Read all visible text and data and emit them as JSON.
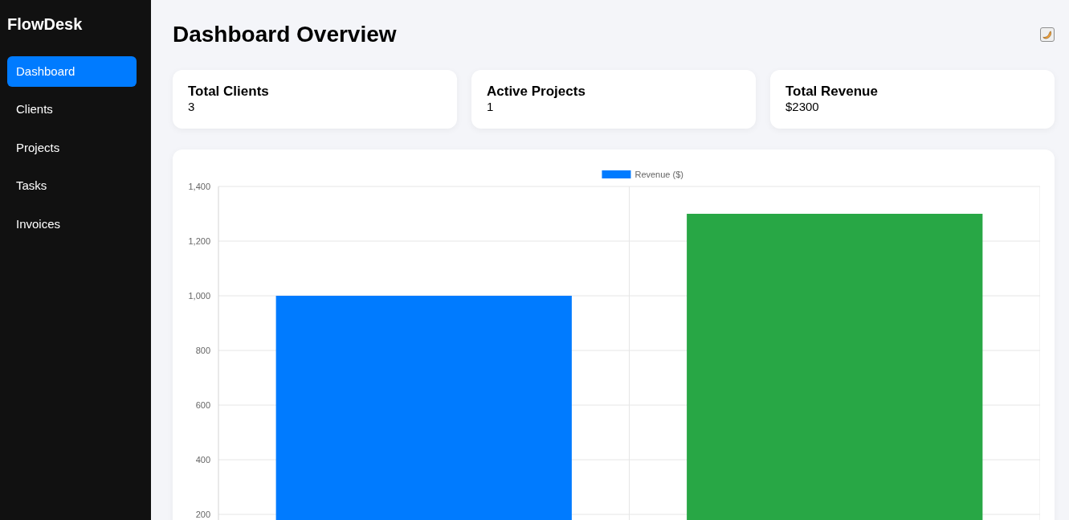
{
  "sidebar": {
    "brand": "FlowDesk",
    "items": [
      {
        "label": "Dashboard",
        "selected": true
      },
      {
        "label": "Clients",
        "selected": false
      },
      {
        "label": "Projects",
        "selected": false
      },
      {
        "label": "Tasks",
        "selected": false
      },
      {
        "label": "Invoices",
        "selected": false
      }
    ]
  },
  "header": {
    "title": "Dashboard Overview"
  },
  "stats": [
    {
      "label": "Total Clients",
      "value": "3"
    },
    {
      "label": "Active Projects",
      "value": "1"
    },
    {
      "label": "Total Revenue",
      "value": "$2300"
    }
  ],
  "revenue_chart": {
    "chart_data": {
      "type": "bar",
      "grid": true,
      "series": [
        {
          "name": "Revenue ($)",
          "color": "#007bff",
          "values": [
            1000,
            null
          ]
        },
        {
          "color": "#28a745",
          "values": [
            null,
            1300
          ]
        }
      ],
      "ylim": [
        0,
        1400
      ],
      "yticks": [
        200,
        400,
        600,
        800,
        {
          "value": 1000,
          "label": "1,000"
        },
        {
          "value": 1200,
          "label": "1,200"
        },
        {
          "value": 1400,
          "label": "1,400"
        }
      ]
    }
  }
}
